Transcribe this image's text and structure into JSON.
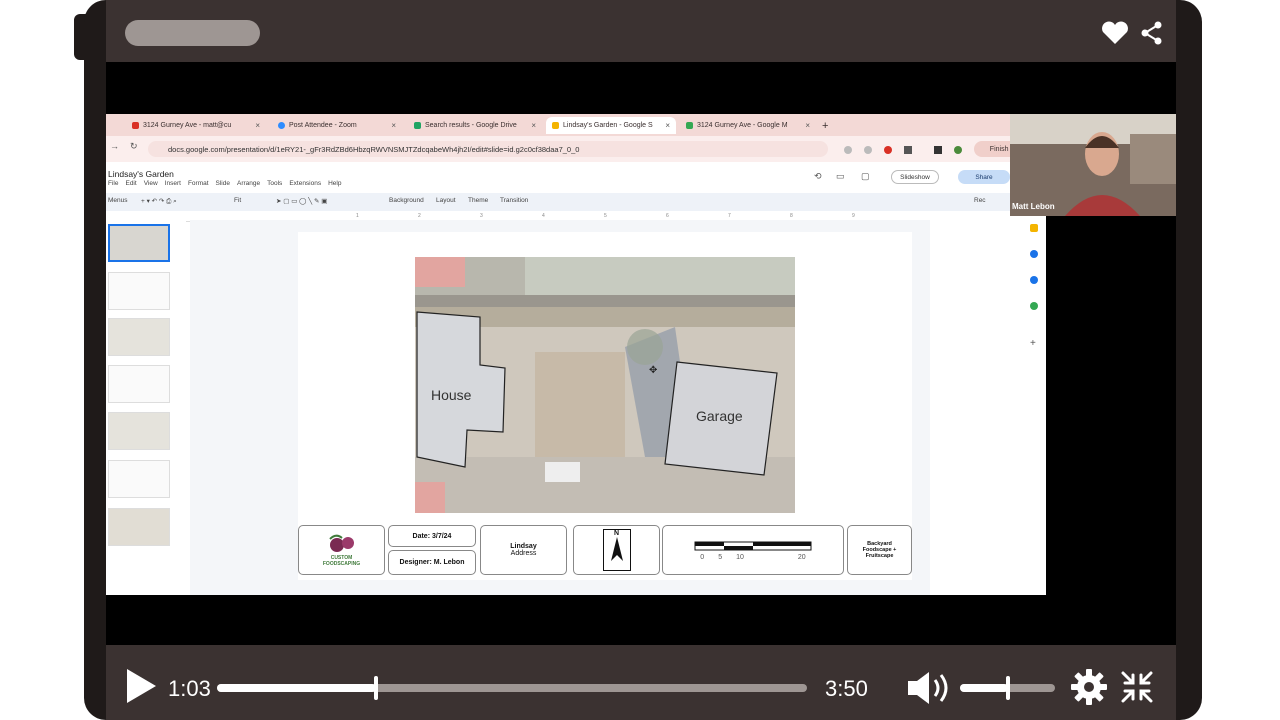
{
  "player": {
    "current_time": "1:03",
    "total_time": "3:50",
    "progress": 0.27,
    "volume": 0.5,
    "icons": [
      "heart-icon",
      "share-icon",
      "play-icon",
      "volume-icon",
      "gear-icon",
      "collapse-icon"
    ]
  },
  "browser": {
    "tabs": [
      {
        "label": "3124 Gurney Ave - matt@cu",
        "color": "#d93025"
      },
      {
        "label": "Post Attendee - Zoom",
        "color": "#2d8cff"
      },
      {
        "label": "Search results - Google Drive",
        "color": "#1fa463"
      },
      {
        "label": "Lindsay's Garden - Google S",
        "color": "#f4b400",
        "active": true
      },
      {
        "label": "3124 Gurney Ave - Google M",
        "color": "#34a853"
      }
    ],
    "url": "docs.google.com/presentation/d/1eRY21-_gFr3RdZBd6HbzqRWVNSMJTZdcqabeWh4jh2I/edit#slide=id.g2c0cf38daa7_0_0",
    "finish_label": "Finish up"
  },
  "slides_app": {
    "doc_title": "Lindsay's Garden",
    "menus": [
      "File",
      "Edit",
      "View",
      "Insert",
      "Format",
      "Slide",
      "Arrange",
      "Tools",
      "Extensions",
      "Help"
    ],
    "toolbar": {
      "menus_label": "Menus",
      "zoom_label": "Fit",
      "background_label": "Background",
      "layout_label": "Layout",
      "theme_label": "Theme",
      "transition_label": "Transition",
      "rec_label": "Rec"
    },
    "slideshow_label": "Slideshow",
    "share_label": "Share",
    "ruler_numbers": [
      "1",
      "2",
      "3",
      "4",
      "5",
      "6",
      "7",
      "8",
      "9"
    ]
  },
  "slide": {
    "house_label": "House",
    "garage_label": "Garage",
    "logo_text_1": "CUSTOM",
    "logo_text_2": "FOODSCAPING",
    "date_label": "Date: 3/7/24",
    "designer_label": "Designer: M. Lebon",
    "client_name": "Lindsay",
    "client_address": "Address",
    "north_label": "N",
    "scale_labels": [
      "0",
      "5",
      "10",
      "20"
    ],
    "project_title": "Backyard Foodscape + Fruitscape"
  },
  "webcam": {
    "name": "Matt Lebon"
  }
}
